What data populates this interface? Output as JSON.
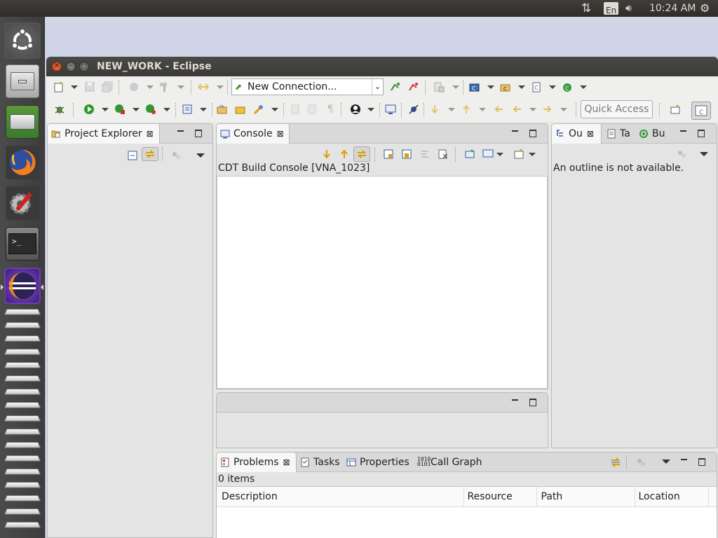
{
  "system": {
    "keyboard_layout": "En",
    "clock": "10:24 AM"
  },
  "launcher": {
    "items": [
      "ubuntu-icon",
      "files-icon",
      "disk-icon",
      "firefox-icon",
      "settings-icon",
      "terminal-icon",
      "eclipse-icon"
    ]
  },
  "window": {
    "title": "NEW_WORK - Eclipse"
  },
  "toolbar": {
    "connection_select": "New Connection...",
    "quick_access": "Quick Access"
  },
  "project_explorer": {
    "tab_label": "Project Explorer"
  },
  "console": {
    "tab_label": "Console",
    "description": "CDT Build Console [VNA_1023]"
  },
  "outline": {
    "tabs": [
      "Ou",
      "Ta",
      "Bu"
    ],
    "message": "An outline is not available."
  },
  "problems": {
    "tabs": [
      "Problems",
      "Tasks",
      "Properties",
      "Call Graph"
    ],
    "count": "0 items",
    "columns": [
      "Description",
      "Resource",
      "Path",
      "Location"
    ]
  },
  "colors": {
    "accent": "#dd4814",
    "eclipse_purple": "#5b2e8f",
    "active_tab": "#f7f7f7"
  }
}
